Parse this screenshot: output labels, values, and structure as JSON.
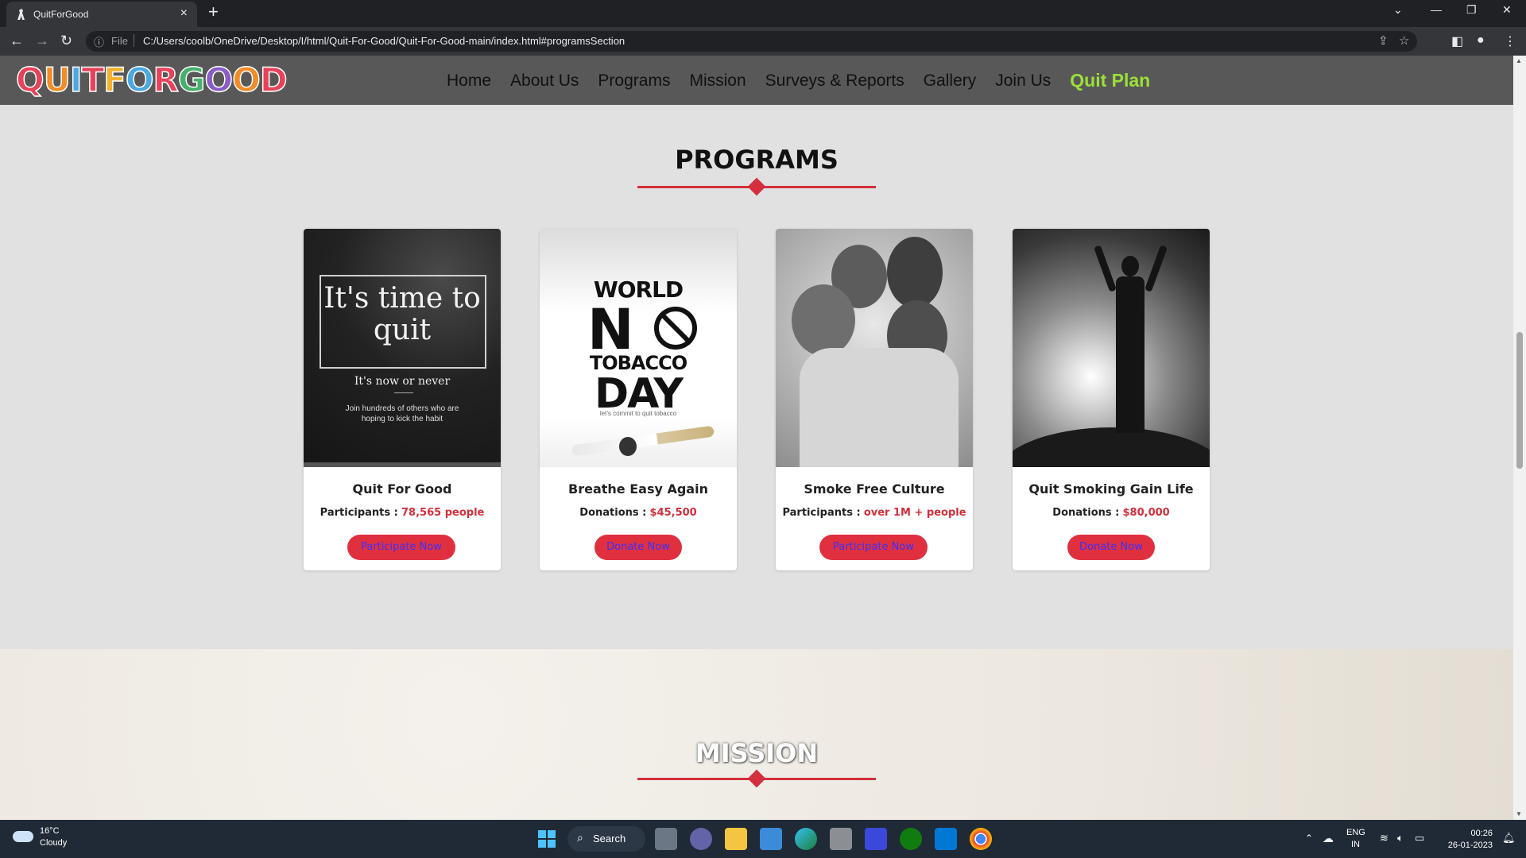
{
  "browser": {
    "tab_title": "QuitForGood",
    "url_scheme": "File",
    "url": "C:/Users/coolb/OneDrive/Desktop/I/html/Quit-For-Good/Quit-For-Good-main/index.html#programsSection"
  },
  "site": {
    "logo_text": "QUITFORGOOD",
    "nav": [
      "Home",
      "About Us",
      "Programs",
      "Mission",
      "Surveys & Reports",
      "Gallery",
      "Join Us"
    ],
    "nav_cta": "Quit Plan"
  },
  "programs": {
    "title": "PROGRAMS",
    "cards": [
      {
        "name": "Quit For Good",
        "stat_label": "Participants :",
        "stat_value": "78,565 people",
        "button": "Participate Now",
        "image_text": {
          "headline": "It's time to quit",
          "sub": "It's now or never",
          "small": "Join hundreds of others who are hoping to kick the habit"
        }
      },
      {
        "name": "Breathe Easy Again",
        "stat_label": "Donations :",
        "stat_value": "$45,500",
        "button": "Donate Now",
        "image_text": {
          "l1": "WORLD",
          "l2": "N",
          "l3": "TOBACCO",
          "l4": "DAY",
          "l5": "let's commit to quit tobacco"
        }
      },
      {
        "name": "Smoke Free Culture",
        "stat_label": "Participants :",
        "stat_value": "over 1M + people",
        "button": "Participate Now"
      },
      {
        "name": "Quit Smoking Gain Life",
        "stat_label": "Donations :",
        "stat_value": "$80,000",
        "button": "Donate Now"
      }
    ]
  },
  "mission": {
    "title": "MISSION"
  },
  "taskbar": {
    "temperature": "16°C",
    "condition": "Cloudy",
    "search": "Search",
    "lang1": "ENG",
    "lang2": "IN",
    "time": "00:26",
    "date": "26-01-2023"
  },
  "colors": {
    "accent_red": "#d32f3c",
    "button_red": "#e0303f",
    "button_text": "#3b2fff",
    "quit_plan_green": "#9be03a",
    "header_bg": "#585858"
  }
}
